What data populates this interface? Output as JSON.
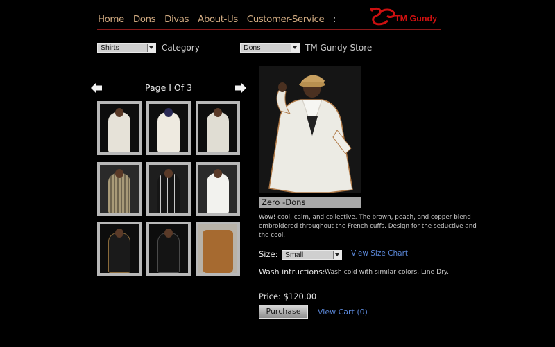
{
  "nav": {
    "items": [
      "Home",
      "Dons",
      "Divas",
      "About-Us",
      "Customer-Service"
    ],
    "separator": ":",
    "logo_text": "TM Gundy"
  },
  "filters": {
    "category_select": "Shirts",
    "category_label": "Category",
    "store_select": "Dons",
    "store_label": "TM Gundy Store"
  },
  "gallery": {
    "page_text": "Page I Of 3"
  },
  "product": {
    "name": "Zero -Dons",
    "description": "Wow! cool, calm, and collective. The brown, peach, and copper blend embroidered throughout the French cuffs. Design for the seductive and the cool.",
    "size_label": "Size:",
    "size_value": "Small",
    "size_chart_link": "View Size Chart",
    "wash_label": "Wash intructions:",
    "wash_value": "Wash cold with similar colors, Line Dry.",
    "price_label": "Price:",
    "price_value": "$120.00",
    "purchase_button": "Purchase",
    "cart_link": "View Cart (0)"
  },
  "colors": {
    "nav_text": "#cfa980",
    "logo_red": "#cc1010",
    "link_blue": "#5a86d6"
  }
}
